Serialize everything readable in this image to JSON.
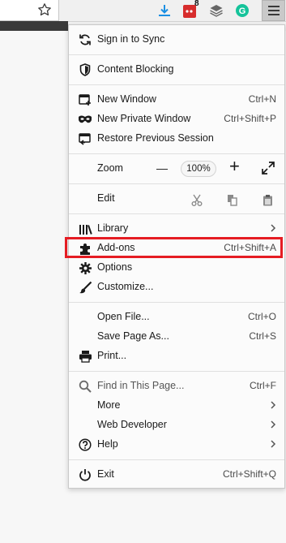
{
  "toolbar": {
    "badge_count": "8",
    "icons": [
      "star-icon",
      "download-icon",
      "extension-icon",
      "layers-icon",
      "grammarly-icon",
      "menu-icon"
    ]
  },
  "menu": {
    "sign_in": "Sign in to Sync",
    "content_blocking": "Content Blocking",
    "new_window": {
      "label": "New Window",
      "shortcut": "Ctrl+N"
    },
    "new_private": {
      "label": "New Private Window",
      "shortcut": "Ctrl+Shift+P"
    },
    "restore": {
      "label": "Restore Previous Session"
    },
    "zoom": {
      "label": "Zoom",
      "minus": "—",
      "value": "100%",
      "plus": "+"
    },
    "edit": {
      "label": "Edit"
    },
    "library": {
      "label": "Library"
    },
    "addons": {
      "label": "Add-ons",
      "shortcut": "Ctrl+Shift+A"
    },
    "options": {
      "label": "Options"
    },
    "customize": {
      "label": "Customize..."
    },
    "open_file": {
      "label": "Open File...",
      "shortcut": "Ctrl+O"
    },
    "save_page": {
      "label": "Save Page As...",
      "shortcut": "Ctrl+S"
    },
    "print": {
      "label": "Print..."
    },
    "find": {
      "label": "Find in This Page...",
      "shortcut": "Ctrl+F"
    },
    "more": {
      "label": "More"
    },
    "web_dev": {
      "label": "Web Developer"
    },
    "help": {
      "label": "Help"
    },
    "exit": {
      "label": "Exit",
      "shortcut": "Ctrl+Shift+Q"
    }
  },
  "colors": {
    "highlight": "#e51c23",
    "download_blue": "#1a8fe3",
    "badge_red": "#d72c2c",
    "grammarly_green": "#15c39a"
  }
}
